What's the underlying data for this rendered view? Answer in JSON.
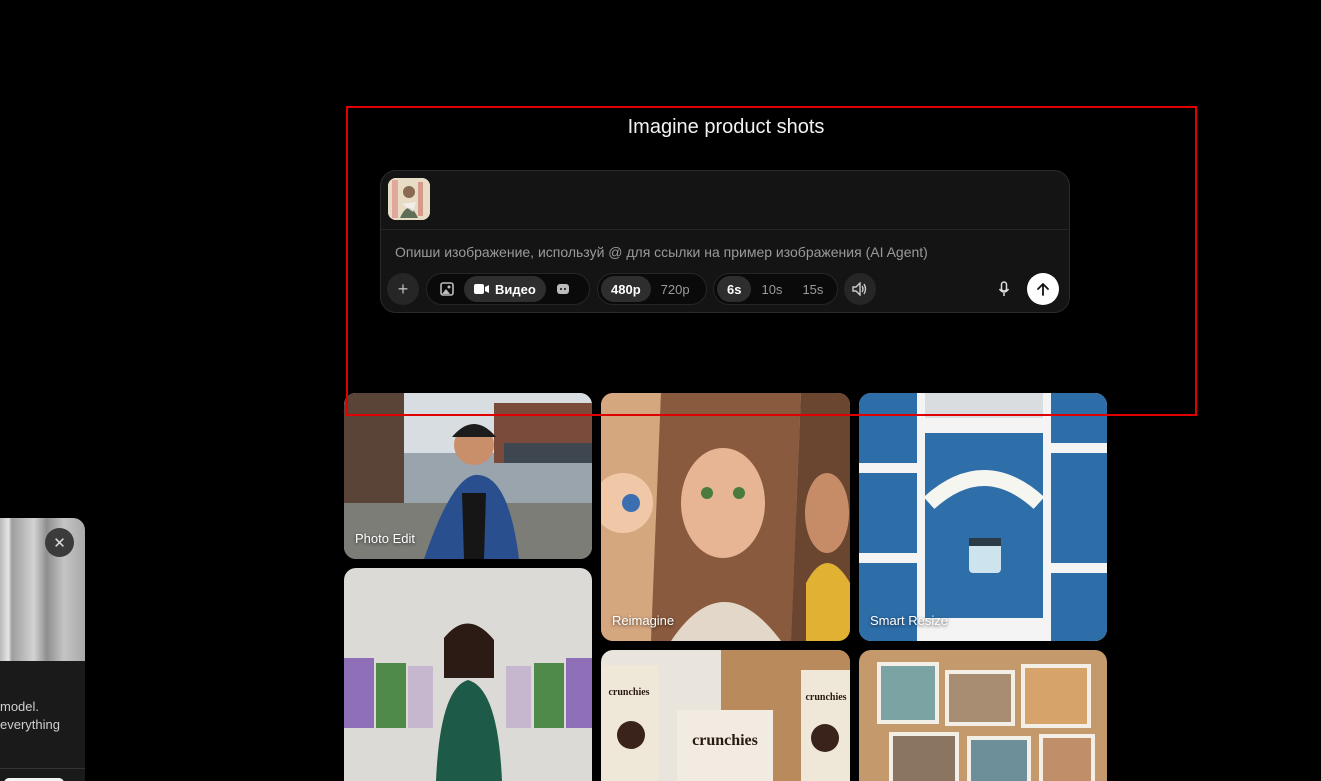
{
  "heading": "Imagine product shots",
  "composer": {
    "placeholder": "Опиши изображение, используй @ для ссылки на пример изображения (AI Agent)",
    "mode_tabs": [
      {
        "label": "",
        "icon": "image-icon",
        "active": false
      },
      {
        "label": "Видео",
        "icon": "video-camera-icon",
        "active": true
      },
      {
        "label": "",
        "icon": "avatar-icon",
        "active": false
      }
    ],
    "resolutions": [
      {
        "label": "480p",
        "active": true
      },
      {
        "label": "720p",
        "active": false
      }
    ],
    "durations": [
      {
        "label": "6s",
        "active": true
      },
      {
        "label": "10s",
        "active": false
      },
      {
        "label": "15s",
        "active": false
      }
    ],
    "icons": [
      "plus-icon",
      "speaker-icon",
      "microphone-icon",
      "arrow-up-icon"
    ]
  },
  "gallery": {
    "cards": [
      {
        "label": "Photo Edit"
      },
      {
        "label": "Reimagine"
      },
      {
        "label": "Smart Resize"
      },
      {
        "label": ""
      },
      {
        "label": ""
      },
      {
        "label": ""
      }
    ]
  },
  "popup": {
    "line1": "model.",
    "line2": "everything"
  },
  "colors": {
    "background": "#000000",
    "highlight_border": "#e00000",
    "composer_bg": "#141414",
    "active_pill": "#2e2e2e",
    "send_button": "#ffffff"
  }
}
